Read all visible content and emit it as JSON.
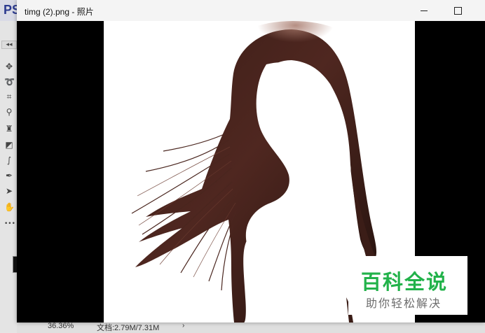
{
  "photoshop": {
    "logo": "PS",
    "status": {
      "zoom": "36.36%",
      "doc_info": "文档:2.79M/7.31M",
      "arrow": "›"
    },
    "tools": [
      {
        "icon": "move-icon",
        "glyph": "✥"
      },
      {
        "icon": "lasso-icon",
        "glyph": "➰"
      },
      {
        "icon": "crop-icon",
        "glyph": "⌗"
      },
      {
        "icon": "eyedropper-icon",
        "glyph": "⚲"
      },
      {
        "icon": "stamp-icon",
        "glyph": "♜"
      },
      {
        "icon": "eraser-icon",
        "glyph": "◩"
      },
      {
        "icon": "brush-icon",
        "glyph": "∫"
      },
      {
        "icon": "pen-icon",
        "glyph": "✒"
      },
      {
        "icon": "select-arrow-icon",
        "glyph": "➤"
      },
      {
        "icon": "hand-icon",
        "glyph": "✋"
      },
      {
        "icon": "more-icon",
        "glyph": "•••"
      }
    ],
    "collapse": "◂◂"
  },
  "window": {
    "title": "timg (2).png - 照片"
  },
  "watermark": {
    "main": "百科全说",
    "sub": "助你轻松解决",
    "brand_color": "#22b24a"
  },
  "colors": {
    "hair_dark": "#2a1511",
    "hair_mid": "#5a2d25",
    "hair_highlight": "#9a6a5c"
  }
}
